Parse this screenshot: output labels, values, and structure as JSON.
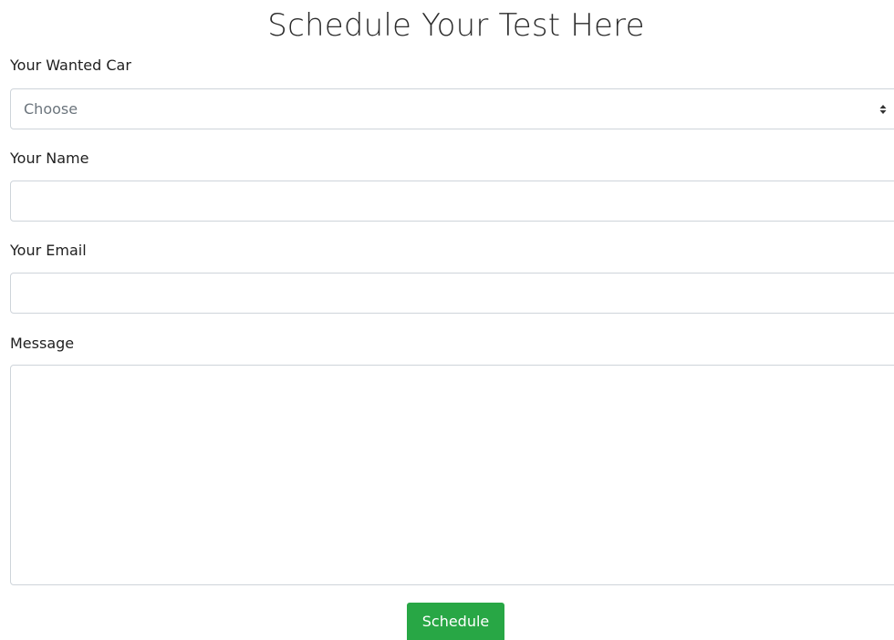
{
  "header": {
    "title": "Schedule Your Test Here"
  },
  "form": {
    "car_label": "Your Wanted Car",
    "car_select_value": "Choose",
    "name_label": "Your Name",
    "name_value": "",
    "email_label": "Your Email",
    "email_value": "",
    "message_label": "Message",
    "message_value": "",
    "submit_label": "Schedule"
  },
  "colors": {
    "button_green": "#28a745",
    "border_gray": "#ced4da",
    "placeholder_gray": "#6c757d"
  },
  "icons": {
    "select_arrow": "updown-caret-icon",
    "textarea_grip": "resize-grip-icon"
  }
}
